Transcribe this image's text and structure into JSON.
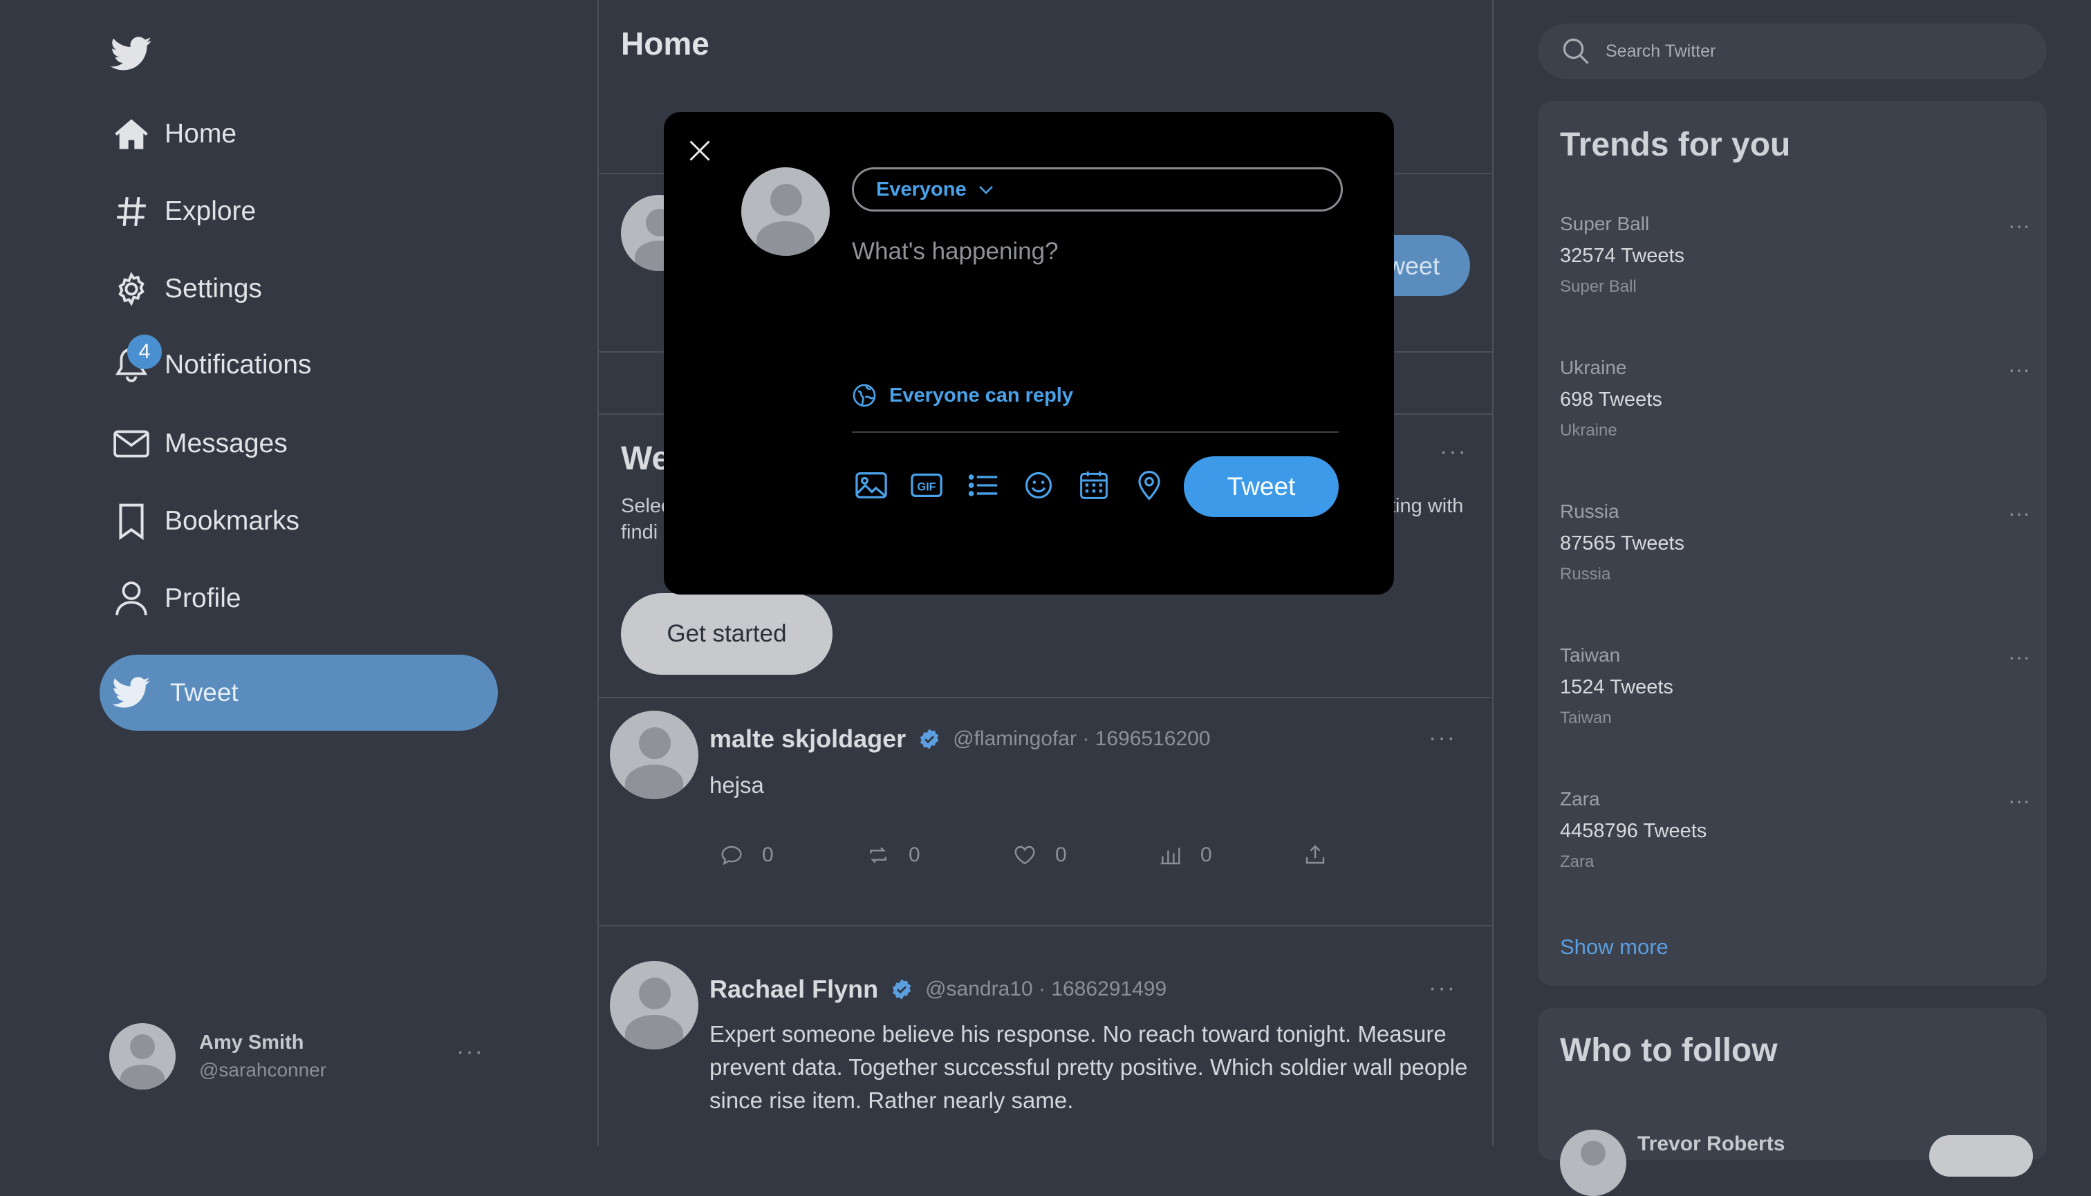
{
  "sidebar": {
    "items": [
      {
        "label": "Home",
        "icon": "home-icon"
      },
      {
        "label": "Explore",
        "icon": "hash-icon"
      },
      {
        "label": "Settings",
        "icon": "gear-icon"
      },
      {
        "label": "Notifications",
        "icon": "bell-icon"
      },
      {
        "label": "Messages",
        "icon": "envelope-icon"
      },
      {
        "label": "Bookmarks",
        "icon": "bookmark-icon"
      },
      {
        "label": "Profile",
        "icon": "user-icon"
      }
    ],
    "notifications_badge": "4",
    "tweet_label": "Tweet",
    "account": {
      "name": "Amy Smith",
      "handle": "@sarahconner",
      "more": "···"
    }
  },
  "main": {
    "title": "Home",
    "ghost_tweet_button": "Tweet",
    "welcome": {
      "title_fragment": "We",
      "desc_left_1": "Selec",
      "desc_left_2": "findi",
      "desc_right": "ting with",
      "more": "···",
      "button": "Get started"
    },
    "posts": [
      {
        "name": "malte skjoldager",
        "meta": "@flamingofar · 1696516200",
        "text": "hejsa",
        "replies": "0",
        "retweets": "0",
        "likes": "0",
        "views": "0",
        "more": "···"
      },
      {
        "name": "Rachael Flynn",
        "meta": "@sandra10 · 1686291499",
        "text": "Expert someone believe his response. No reach toward tonight. Measure prevent data. Together successful pretty positive. Which soldier wall people since rise item. Rather nearly same.",
        "more": "···"
      }
    ]
  },
  "right": {
    "search_placeholder": "Search Twitter",
    "trends_title": "Trends for you",
    "trends": [
      {
        "name": "Super Ball",
        "count": "32574 Tweets",
        "sub": "Super Ball"
      },
      {
        "name": "Ukraine",
        "count": "698 Tweets",
        "sub": "Ukraine"
      },
      {
        "name": "Russia",
        "count": "87565 Tweets",
        "sub": "Russia"
      },
      {
        "name": "Taiwan",
        "count": "1524 Tweets",
        "sub": "Taiwan"
      },
      {
        "name": "Zara",
        "count": "4458796 Tweets",
        "sub": "Zara"
      }
    ],
    "trend_more": "···",
    "show_more": "Show more",
    "follow_title": "Who to follow",
    "follow_first_name": "Trevor Roberts"
  },
  "modal": {
    "audience": "Everyone",
    "placeholder": "What's happening?",
    "reply_setting": "Everyone can reply",
    "tools": [
      "image-icon",
      "gif-icon",
      "poll-icon",
      "emoji-icon",
      "schedule-icon",
      "location-icon"
    ],
    "gif_label": "GIF",
    "tweet_button": "Tweet"
  },
  "colors": {
    "background": "#333842",
    "accent": "#3d9ae8",
    "sidebar_tweet": "#5a8cbd",
    "modal": "#000000"
  }
}
